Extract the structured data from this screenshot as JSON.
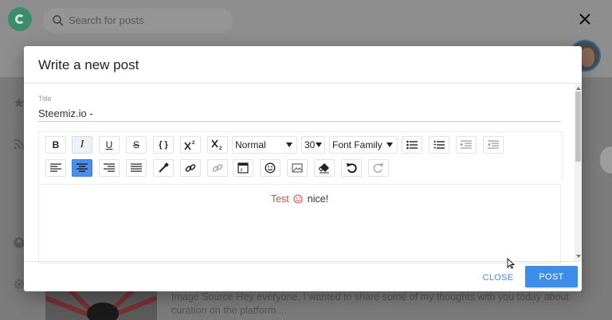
{
  "background": {
    "search_placeholder": "Search for posts",
    "post_snippet": "Image Source Hey everyone, I wanted to share some of my thoughts with you today about curation on the platform...."
  },
  "modal": {
    "title": "Write a new post",
    "title_field": {
      "label": "Title",
      "value": "Steemiz.io -"
    },
    "toolbar": {
      "bold_label": "B",
      "italic_label": "I",
      "underline_label": "U",
      "strike_label": "S",
      "code_label": "{ }",
      "block_type": "Normal",
      "font_size": "30",
      "font_family": "Font Family"
    },
    "editor": {
      "text_red": "Test",
      "text_rest": "nice!"
    },
    "actions": {
      "close_label": "CLOSE",
      "post_label": "POST"
    }
  },
  "colors": {
    "accent": "#3e8ee8",
    "active_align": "#4a8fe8",
    "text_red": "#d94a4a"
  }
}
